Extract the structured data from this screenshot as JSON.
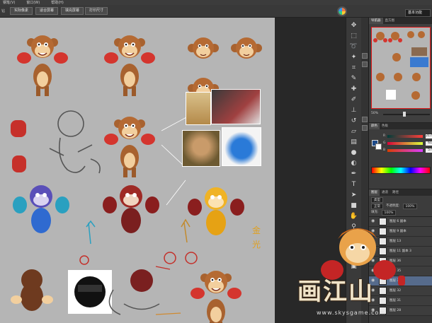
{
  "menubar": {
    "items": [
      "钢笔(V)",
      "窗口(W)",
      "帮助(H)"
    ]
  },
  "options": {
    "lead": "钻",
    "buttons": [
      "实际像素",
      "适合屏幕",
      "填充屏幕",
      "打印尺寸"
    ],
    "workspace": "基本功能"
  },
  "tools": [
    "move-tool",
    "marquee-tool",
    "lasso-tool",
    "magic-wand-tool",
    "crop-tool",
    "eyedropper-tool",
    "healing-tool",
    "brush-tool",
    "stamp-tool",
    "history-brush-tool",
    "eraser-tool",
    "gradient-tool",
    "blur-tool",
    "dodge-tool",
    "pen-tool",
    "type-tool",
    "path-select-tool",
    "shape-tool",
    "hand-tool",
    "zoom-tool"
  ],
  "navigator": {
    "tabs": [
      "导航器",
      "直方图"
    ],
    "zoom": "50%"
  },
  "color": {
    "tabs": [
      "颜色",
      "色板"
    ],
    "rows": [
      {
        "label": "R",
        "value": "217"
      },
      {
        "label": "G",
        "value": "61"
      },
      {
        "label": "B",
        "value": "57"
      }
    ],
    "fg": "#1d4a8a",
    "bg": "#ffffff"
  },
  "layers": {
    "tabs": [
      "图层",
      "通道",
      "路径"
    ],
    "kind": "类型",
    "blend": "正常",
    "opacity_label": "不透明度:",
    "opacity": "100%",
    "fill_label": "填充:",
    "fill": "100%",
    "items": [
      "图层 6 副本",
      "图层 9 副本",
      "图层 13",
      "图层 11 副本 3",
      "图层 36",
      "图层 35",
      "图层 34",
      "图层 32",
      "图层 31",
      "图层 28"
    ],
    "selected_index": 6
  },
  "watermark": {
    "title": "画江山",
    "url": "www.skysgame.com"
  }
}
